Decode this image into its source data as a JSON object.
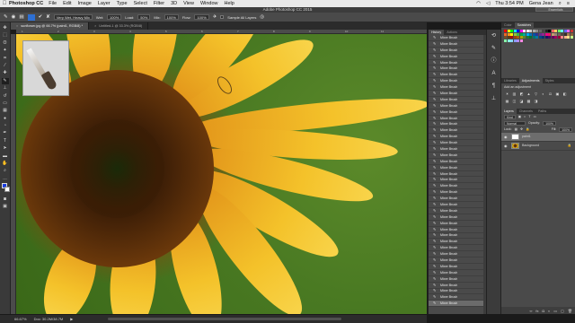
{
  "menubar": {
    "apple": "",
    "app_name": "Photoshop CC",
    "items": [
      "File",
      "Edit",
      "Image",
      "Layer",
      "Type",
      "Select",
      "Filter",
      "3D",
      "View",
      "Window",
      "Help"
    ],
    "clock": "Thu 3:54 PM",
    "user": "Gena Jean"
  },
  "title": "Adobe Photoshop CC 2015",
  "workspace": "Essentials",
  "options": {
    "preset": "Very Wet, Heavy Mix",
    "wet_label": "Wet:",
    "wet_value": "100%",
    "load_label": "Load:",
    "load_value": "50%",
    "mix_label": "Mix:",
    "mix_value": "100%",
    "flow_label": "Flow:",
    "flow_value": "100%",
    "sample_label": "Sample All Layers"
  },
  "tabs": [
    {
      "label": "sunflower.jpg @ 66.7% (paint1, RGB/8) *",
      "active": true
    },
    {
      "label": "Untitled-1 @ 33.3% (RGB/8)",
      "active": false
    }
  ],
  "ruler_numbers": [
    "1",
    "2",
    "3",
    "4",
    "5",
    "6",
    "7",
    "8",
    "9",
    "10",
    "11"
  ],
  "status": {
    "zoom": "66.67%",
    "doc": "Doc: 30.2M/38.7M"
  },
  "history": {
    "tabs": [
      "History",
      "Actions"
    ],
    "item_label": "Mixer Brush",
    "count": 44
  },
  "swatches_panel": {
    "tabs": [
      "Color",
      "Swatches"
    ],
    "colors": [
      "#ff0000",
      "#ffff00",
      "#00ff00",
      "#00ffff",
      "#0000ff",
      "#ff00ff",
      "#ffffff",
      "#eeeeee",
      "#cccccc",
      "#aaaaaa",
      "#888888",
      "#666666",
      "#444444",
      "#222222",
      "#000000",
      "#ff6666",
      "#ffcc66",
      "#66ff66",
      "#66ffff",
      "#6666ff",
      "#ff66ff",
      "#cc3333",
      "#f26522",
      "#f7941d",
      "#fff200",
      "#8dc63f",
      "#39b54a",
      "#00a651",
      "#00a99d",
      "#00aeef",
      "#0072bc",
      "#0054a6",
      "#2e3192",
      "#662d91",
      "#92278f",
      "#ec008c",
      "#ed145b",
      "#c69c6d",
      "#998675",
      "#736357",
      "#534741",
      "#362f2d",
      "#a67c52",
      "#8c6239",
      "#754c24",
      "#603913",
      "#9e0b0f",
      "#a0410d",
      "#a3620a",
      "#aba000",
      "#598527",
      "#1a7b30",
      "#007236",
      "#00746b",
      "#0076a3",
      "#004a80",
      "#003471",
      "#1b1464",
      "#440e62",
      "#630460",
      "#9e005d",
      "#9e0039",
      "#ff8888",
      "#ffb388",
      "#ffe088",
      "#c6ff88",
      "#88ffa8",
      "#88ffe6",
      "#88d8ff",
      "#889cff",
      "#b388ff",
      "#ff88e6"
    ]
  },
  "adjustments": {
    "tabs": [
      "Libraries",
      "Adjustments",
      "Styles"
    ],
    "label": "Add an adjustment",
    "icons": [
      "☀",
      "▥",
      "◩",
      "▲",
      "▽",
      "◐",
      "⚖",
      "▣",
      "◧",
      "▦",
      "◫",
      "◪",
      "▩",
      "◨"
    ]
  },
  "layers": {
    "tabs": [
      "Layers",
      "Channels",
      "Paths"
    ],
    "kind": "Kind",
    "blend": "Normal",
    "opacity_label": "Opacity:",
    "opacity": "100%",
    "lock_label": "Lock:",
    "fill_label": "Fill:",
    "fill": "100%",
    "items": [
      {
        "name": "paint1",
        "selected": true
      },
      {
        "name": "Background",
        "selected": false
      }
    ]
  }
}
